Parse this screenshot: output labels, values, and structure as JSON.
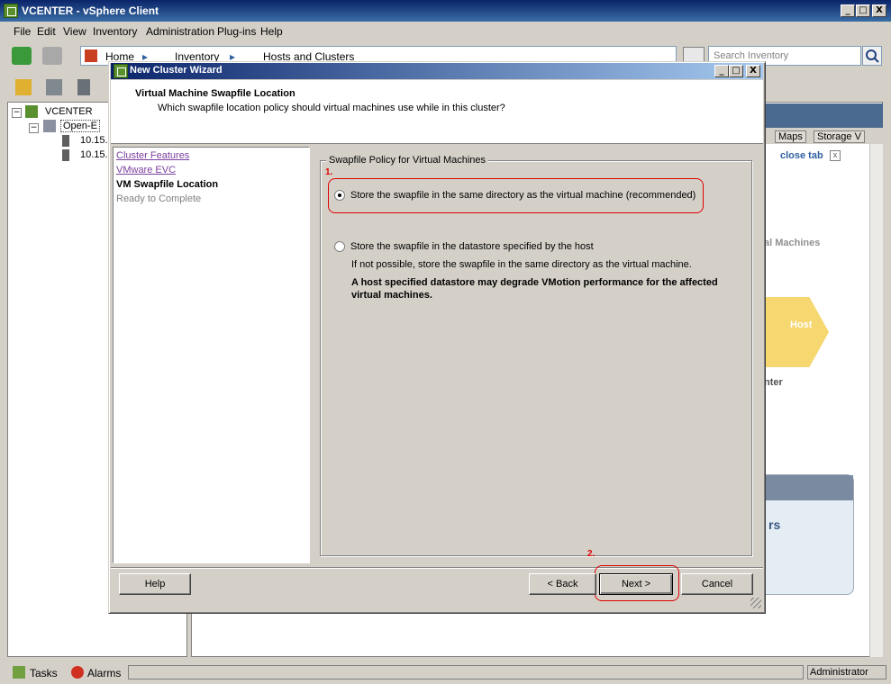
{
  "window": {
    "title": "VCENTER - vSphere Client",
    "min": "_",
    "max": "□",
    "close": "X"
  },
  "menu": [
    "File",
    "Edit",
    "View",
    "Inventory",
    "Administration",
    "Plug-ins",
    "Help"
  ],
  "address": {
    "home": "Home",
    "sep": "▸",
    "inventory": "Inventory",
    "hosts": "Hosts and Clusters"
  },
  "search": {
    "placeholder": "Search Inventory"
  },
  "tree": {
    "root": "VCENTER",
    "datacenter": "Open-E",
    "host1": "10.15.",
    "host2": "10.15."
  },
  "right_panel": {
    "tab_maps": "Maps",
    "tab_storage": "Storage V",
    "close_tab": "close tab",
    "bg_vms": "al Machines",
    "bg_host": "Host",
    "bg_center": "nter",
    "bg_rs": "rs"
  },
  "statusbar": {
    "tasks": "Tasks",
    "alarms": "Alarms",
    "user": "Administrator"
  },
  "wizard": {
    "title": "New Cluster Wizard",
    "header_title": "Virtual Machine Swapfile Location",
    "header_subtitle": "Which swapfile location policy should virtual machines use while in this cluster?",
    "steps": [
      "Cluster Features",
      "VMware EVC",
      "VM Swapfile Location",
      "Ready to Complete"
    ],
    "group_title": "Swapfile Policy for Virtual Machines",
    "option1": "Store the swapfile in the same directory as the virtual machine (recommended)",
    "option2": "Store the swapfile in the datastore specified by the host",
    "option2_note": "If not possible, store the swapfile in the same directory as the virtual machine.",
    "option2_warning": "A host specified datastore may degrade VMotion performance for the affected virtual machines.",
    "annotation1": "1.",
    "annotation2": "2.",
    "buttons": {
      "help": "Help",
      "back": "< Back",
      "next": "Next >",
      "cancel": "Cancel"
    }
  },
  "colors": {
    "annotation": "#e00000",
    "title_bar": "#0a246a",
    "link_visited": "#7b3fa0"
  }
}
